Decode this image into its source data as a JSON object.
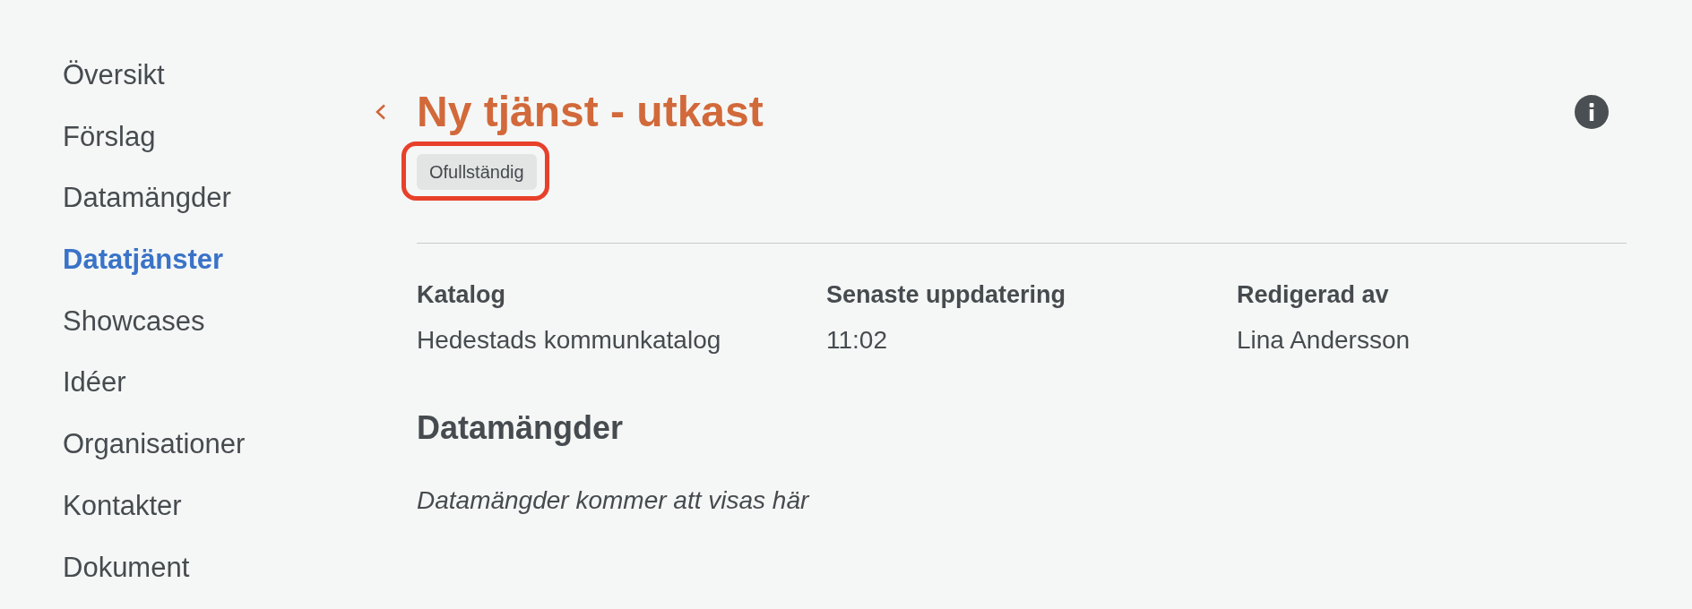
{
  "sidebar": {
    "items": [
      {
        "label": "Översikt",
        "selected": false
      },
      {
        "label": "Förslag",
        "selected": false
      },
      {
        "label": "Datamängder",
        "selected": false
      },
      {
        "label": "Datatjänster",
        "selected": true
      },
      {
        "label": "Showcases",
        "selected": false
      },
      {
        "label": "Idéer",
        "selected": false
      },
      {
        "label": "Organisationer",
        "selected": false
      },
      {
        "label": "Kontakter",
        "selected": false
      },
      {
        "label": "Dokument",
        "selected": false
      }
    ]
  },
  "header": {
    "title": "Ny tjänst - utkast",
    "status_badge": {
      "label": "Ofullständig",
      "highlighted": true
    }
  },
  "details": [
    {
      "label": "Katalog",
      "value": "Hedestads kommunkatalog"
    },
    {
      "label": "Senaste uppdatering",
      "value": "11:02"
    },
    {
      "label": "Redigerad av",
      "value": "Lina Andersson"
    }
  ],
  "datasets_section": {
    "heading": "Datamängder",
    "empty_message": "Datamängder kommer att visas här"
  }
}
